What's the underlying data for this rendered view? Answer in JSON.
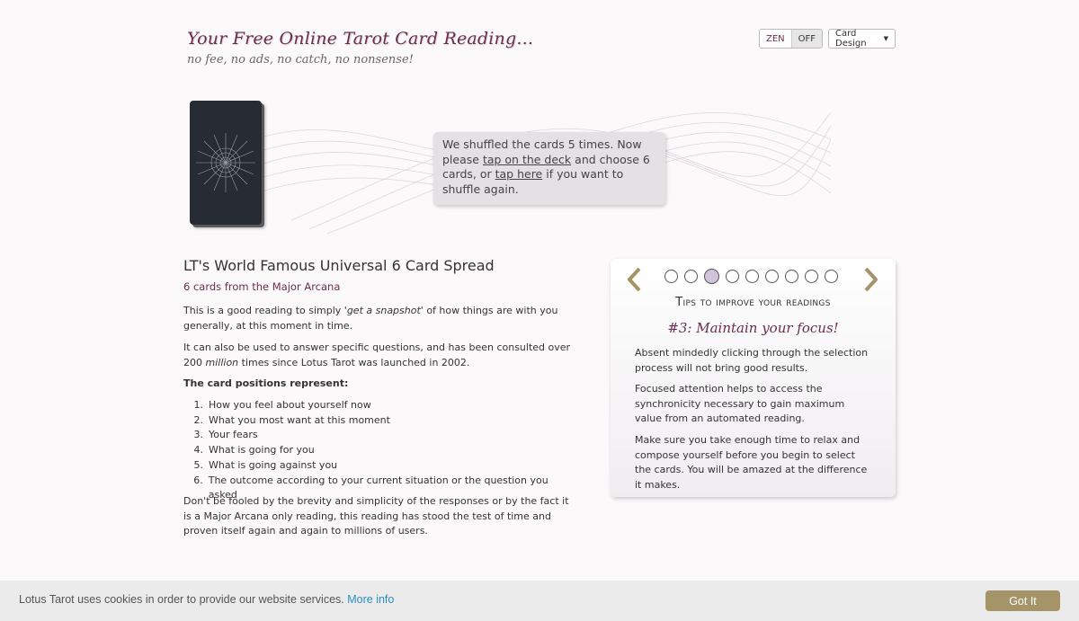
{
  "header": {
    "title": "Your Free Online Tarot Card Reading...",
    "subtitle": "no fee, no ads, no catch, no nonsense!",
    "zen_label": "ZEN",
    "zen_state": "OFF",
    "card_design_label": "Card Design"
  },
  "banner": {
    "message_start": "We shuffled the cards 5 times. Now please ",
    "link_deck": "tap on the deck",
    "message_mid": " and choose 6 cards, or ",
    "link_shuffle": "tap here",
    "message_end": " if you want to shuffle again."
  },
  "spread": {
    "title": "LT's World Famous Universal 6 Card Spread",
    "subtitle": "6 cards from the Major Arcana",
    "p1_start": "This is a good reading to simply ",
    "p1_em": "'get a snapshot'",
    "p1_end": " of how things are with you generally, at this moment in time.",
    "p2_start": "It can also be used to answer specific questions, and has been consulted over 200 ",
    "p2_em": "million",
    "p2_end": " times since Lotus Tarot was launched in 2002.",
    "positions_heading": "The card positions represent:",
    "positions": [
      {
        "num": "1.",
        "text": "How you feel about yourself now"
      },
      {
        "num": "2.",
        "text": "What you most want at this moment"
      },
      {
        "num": "3.",
        "text": "Your fears"
      },
      {
        "num": "4.",
        "text": "What is going for you"
      },
      {
        "num": "5.",
        "text": "What is going against you"
      },
      {
        "num": "6.",
        "text": "The outcome according to your current situation or the question you asked"
      }
    ],
    "closing": "Don't be fooled by the brevity and simplicity of the responses or by the fact it is a Major Arcana only reading, this reading has stood the test of time and proven itself again and again to millions of users."
  },
  "tips": {
    "heading": "Tips to improve your readings",
    "tip_title": "#3: Maintain your focus!",
    "slide_count": 9,
    "active_slide": 3,
    "paragraphs": [
      "Absent mindedly clicking through the selection process will not bring good results.",
      "Focused attention helps to access the synchronicity necessary to gain maximum value from an automated reading.",
      "Make sure you take enough time to relax and compose yourself before you begin to select the cards. You will be amazed at the difference it makes."
    ]
  },
  "cookie": {
    "text": "Lotus Tarot uses cookies in order to provide our website services.",
    "link": "More info",
    "button": "Got It"
  },
  "colors": {
    "brand": "#6e2b4e",
    "arrow": "#a49467",
    "active_dot": "#d2c3dc",
    "link": "#2a8fc8"
  }
}
